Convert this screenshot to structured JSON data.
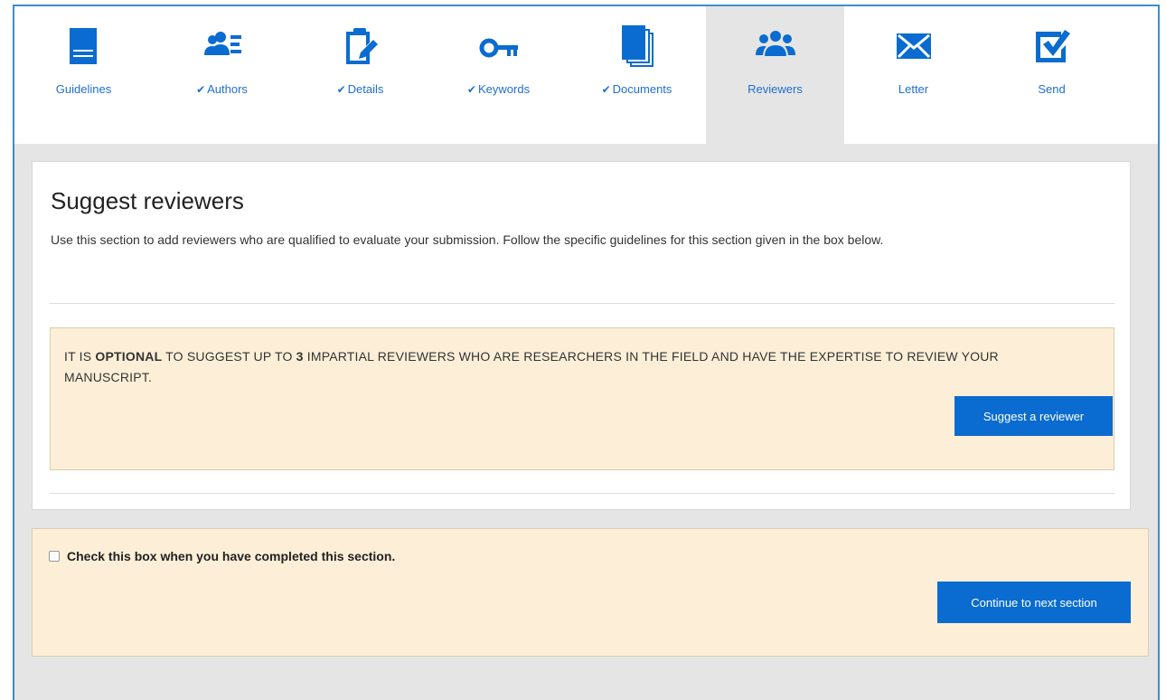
{
  "colors": {
    "accent": "#0a6cd0",
    "tab_text": "#1f6fd0",
    "notice_bg": "#fdefd7",
    "frame_border": "#3b8ed0"
  },
  "tabs": [
    {
      "label": "Guidelines",
      "icon": "book-icon",
      "done": false,
      "active": false
    },
    {
      "label": "Authors",
      "icon": "authors-list-icon",
      "done": true,
      "active": false
    },
    {
      "label": "Details",
      "icon": "clipboard-edit-icon",
      "done": true,
      "active": false
    },
    {
      "label": "Keywords",
      "icon": "key-icon",
      "done": true,
      "active": false
    },
    {
      "label": "Documents",
      "icon": "documents-stack-icon",
      "done": true,
      "active": false
    },
    {
      "label": "Reviewers",
      "icon": "users-group-icon",
      "done": false,
      "active": true
    },
    {
      "label": "Letter",
      "icon": "envelope-icon",
      "done": false,
      "active": false
    },
    {
      "label": "Send",
      "icon": "checkbox-edit-icon",
      "done": false,
      "active": false
    }
  ],
  "check_glyph": "✔",
  "section": {
    "title": "Suggest reviewers",
    "intro": "Use this section to add reviewers who are qualified to evaluate your submission. Follow the specific guidelines for this section given in the box below."
  },
  "notice": {
    "part1": "IT IS ",
    "bold1": "OPTIONAL",
    "part2": " TO SUGGEST UP TO ",
    "bold2": "3",
    "part3": " IMPARTIAL REVIEWERS WHO ARE RESEARCHERS IN THE FIELD AND HAVE THE EXPERTISE TO REVIEW YOUR MANUSCRIPT.",
    "button_label": "Suggest a reviewer"
  },
  "completion": {
    "checkbox_label": "Check this box when you have completed this section.",
    "checked": false,
    "button_label": "Continue to next section"
  }
}
